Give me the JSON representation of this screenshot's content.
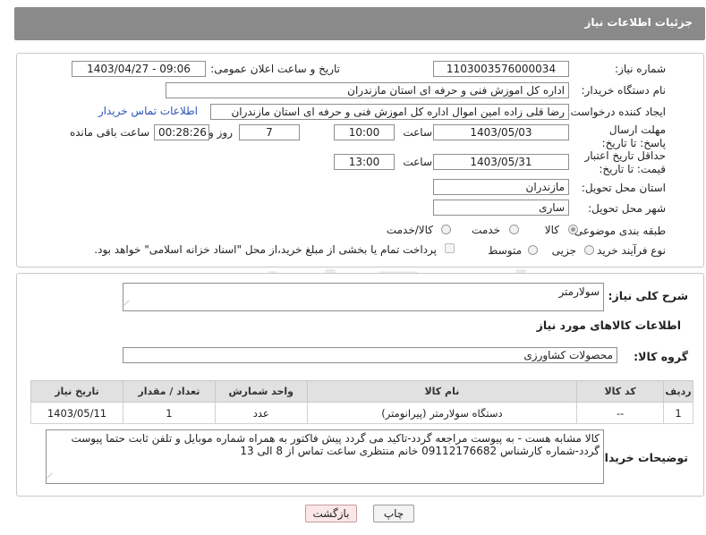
{
  "header": {
    "title": "جزئیات اطلاعات نیاز"
  },
  "need_number": {
    "label": "شماره نیاز:",
    "value": "1103003576000034"
  },
  "announce": {
    "label": "تاریخ و ساعت اعلان عمومی:",
    "value": "1403/04/27 - 09:06"
  },
  "buyer_org": {
    "label": "نام دستگاه خریدار:",
    "value": "اداره کل اموزش فنی و حرفه ای استان مازندران"
  },
  "requester": {
    "label": "ایجاد کننده درخواست:",
    "value": "رضا قلی زاده امین اموال اداره کل اموزش فنی و حرفه ای استان مازندران",
    "contact_link": "اطلاعات تماس خریدار"
  },
  "deadline": {
    "label": "مهلت ارسال پاسخ: تا تاریخ:",
    "date": "1403/05/03",
    "time_label": "ساعت",
    "time": "10:00",
    "days": "7",
    "days_label": "روز و",
    "remaining": "00:28:26",
    "remaining_label": "ساعت باقی مانده"
  },
  "price_validity": {
    "label": "حداقل تاریخ اعتبار قیمت: تا تاریخ:",
    "date": "1403/05/31",
    "time_label": "ساعت",
    "time": "13:00"
  },
  "province": {
    "label": "استان محل تحویل:",
    "value": "مازندران"
  },
  "city": {
    "label": "شهر محل تحویل:",
    "value": "ساری"
  },
  "category": {
    "label": "طبقه بندی موضوعی:",
    "options": [
      "کالا",
      "خدمت",
      "کالا/خدمت"
    ],
    "selected": "کالا"
  },
  "process": {
    "label": "نوع فرآیند خرید :",
    "options": [
      "جزیی",
      "متوسط"
    ],
    "payment_note": "پرداخت تمام یا بخشی از مبلغ خرید،از محل \"اسناد خزانه اسلامی\" خواهد بود."
  },
  "description": {
    "label": "شرح کلی نیاز:",
    "value": "سولارمتر"
  },
  "goods_info_title": "اطلاعات کالاهای مورد نیاز",
  "goods_group": {
    "label": "گروه کالا:",
    "value": "محصولات کشاورزی"
  },
  "table": {
    "headers": [
      "ردیف",
      "کد کالا",
      "نام کالا",
      "واحد شمارش",
      "تعداد / مقدار",
      "تاریخ نیاز"
    ],
    "rows": [
      [
        "1",
        "--",
        "دستگاه سولارمتر (پیرانومتر)",
        "عدد",
        "1",
        "1403/05/11"
      ]
    ]
  },
  "buyer_notes": {
    "label": "توضیحات خریدار:",
    "value": "کالا مشابه هست - به پیوست مراجعه گردد-تاکید می گردد پیش فاکتور به همراه شماره موبایل و تلفن ثابت حتما پیوست گردد-شماره کارشناس 09112176682 خانم منتظری ساعت تماس از 8 الی 13"
  },
  "buttons": {
    "print": "چاپ",
    "back": "بازگشت"
  },
  "watermark": {
    "text": "AriaTender.net"
  },
  "colors": {
    "header_bg": "#8a8a8a",
    "link": "#2a55b8",
    "back_button_bg": "#fbe7e7"
  }
}
